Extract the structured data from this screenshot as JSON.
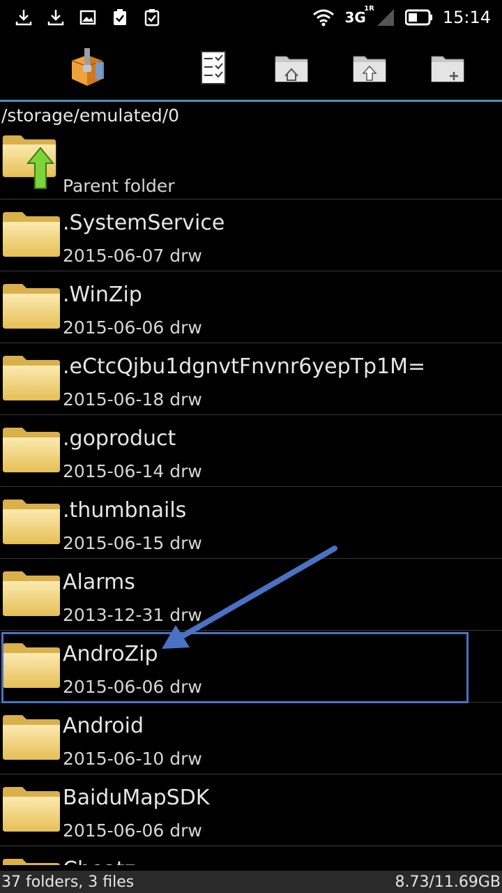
{
  "status_bar": {
    "left_icons": [
      "download-icon",
      "download-icon",
      "image-icon",
      "clipboard-check-icon",
      "clipboard-check-icon"
    ],
    "network": "3G",
    "network_sup": "1R",
    "time": "15:14"
  },
  "toolbar": {
    "app_icon": "androzip-app-icon",
    "buttons": [
      {
        "name": "select-list-icon"
      },
      {
        "name": "home-folder-icon"
      },
      {
        "name": "up-folder-icon"
      },
      {
        "name": "new-folder-icon"
      }
    ]
  },
  "path": "/storage/emulated/0",
  "list": {
    "parent_label": "Parent folder",
    "items": [
      {
        "name": ".SystemService",
        "meta": "2015-06-07 drw"
      },
      {
        "name": ".WinZip",
        "meta": "2015-06-06 drw"
      },
      {
        "name": ".eCtcQjbu1dgnvtFnvnr6yepTp1M=",
        "meta": "2015-06-18 drw"
      },
      {
        "name": ".goproduct",
        "meta": "2015-06-14 drw"
      },
      {
        "name": ".thumbnails",
        "meta": "2015-06-15 drw"
      },
      {
        "name": "Alarms",
        "meta": "2013-12-31 drw"
      },
      {
        "name": "AndroZip",
        "meta": "2015-06-06 drw"
      },
      {
        "name": "Android",
        "meta": "2015-06-10 drw"
      },
      {
        "name": "BaiduMapSDK",
        "meta": "2015-06-06 drw"
      },
      {
        "name": "Cheatz",
        "meta": ""
      }
    ]
  },
  "footer": {
    "counts": "37 folders, 3 files",
    "storage": "8.73/11.69GB"
  },
  "colors": {
    "accent_line": "#4e8fb8",
    "highlight": "#4a72c4",
    "folder": "#f1d277"
  }
}
